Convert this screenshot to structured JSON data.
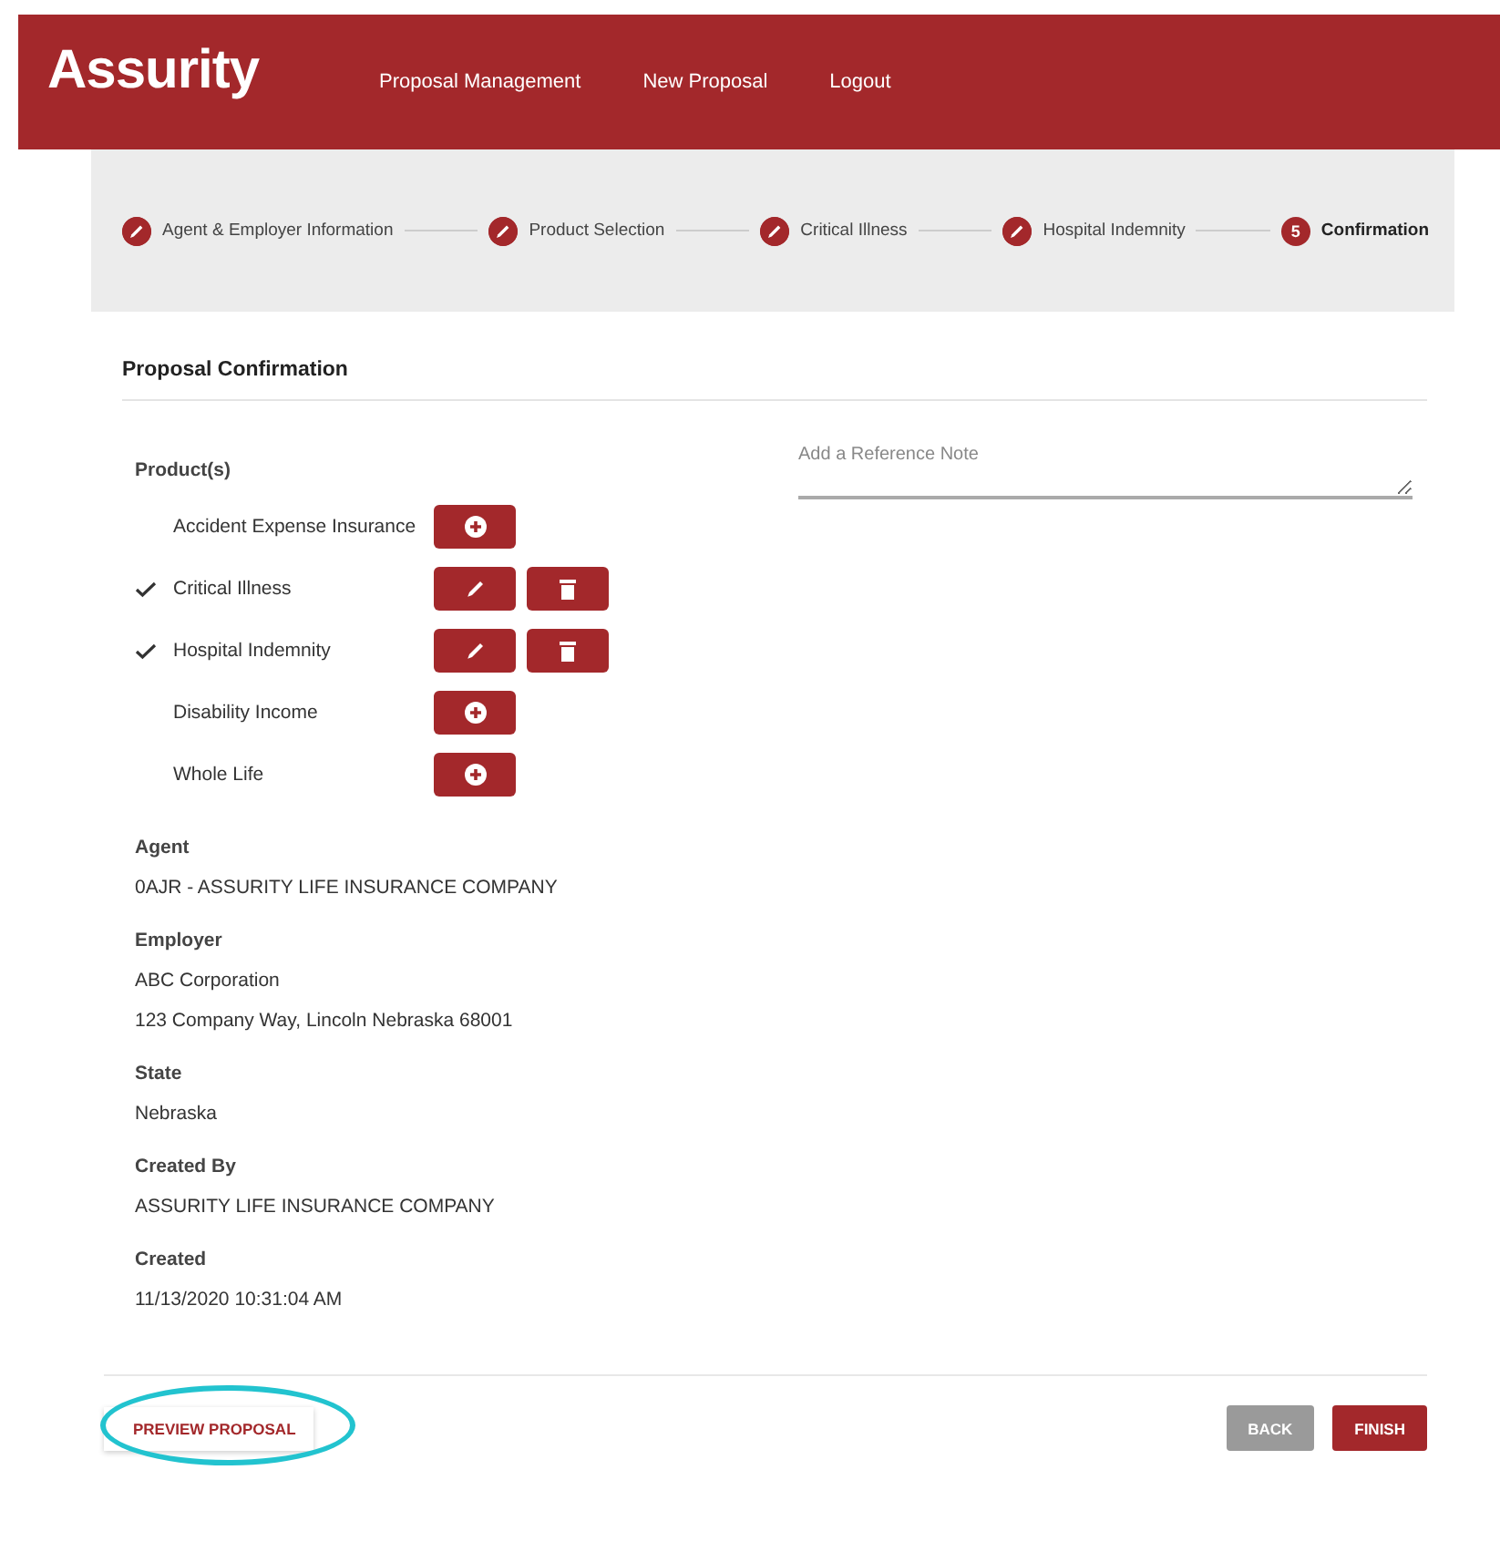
{
  "header": {
    "logo": "Assurity",
    "nav": [
      {
        "label": "Proposal Management"
      },
      {
        "label": "New Proposal"
      },
      {
        "label": "Logout"
      }
    ]
  },
  "steps": [
    {
      "label": "Agent & Employer Information",
      "completed": true,
      "selected": false
    },
    {
      "label": "Product Selection",
      "completed": true,
      "selected": false
    },
    {
      "label": "Critical Illness",
      "completed": true,
      "selected": false
    },
    {
      "label": "Hospital Indemnity",
      "completed": true,
      "selected": false
    },
    {
      "label": "Confirmation",
      "completed": false,
      "selected": true,
      "number": "5"
    }
  ],
  "title": "Proposal Confirmation",
  "products_label": "Product(s)",
  "products": [
    {
      "name": "Accident Expense Insurance",
      "checked": false
    },
    {
      "name": "Critical Illness",
      "checked": true
    },
    {
      "name": "Hospital Indemnity",
      "checked": true
    },
    {
      "name": "Disability Income",
      "checked": false
    },
    {
      "name": "Whole Life",
      "checked": false
    }
  ],
  "reference_note": {
    "placeholder": "Add a Reference Note"
  },
  "details": [
    {
      "label": "Agent",
      "values": [
        "0AJR - ASSURITY LIFE INSURANCE COMPANY"
      ]
    },
    {
      "label": "Employer",
      "values": [
        "ABC Corporation",
        "123 Company Way, Lincoln Nebraska 68001"
      ]
    },
    {
      "label": "State",
      "values": [
        "Nebraska"
      ]
    },
    {
      "label": "Created By",
      "values": [
        "ASSURITY LIFE INSURANCE COMPANY"
      ]
    },
    {
      "label": "Created",
      "values": [
        "11/13/2020 10:31:04 AM"
      ]
    }
  ],
  "footer": {
    "preview": {
      "label": "PREVIEW PROPOSAL",
      "highlighted": true
    },
    "back": "BACK",
    "finish": "FINISH"
  }
}
